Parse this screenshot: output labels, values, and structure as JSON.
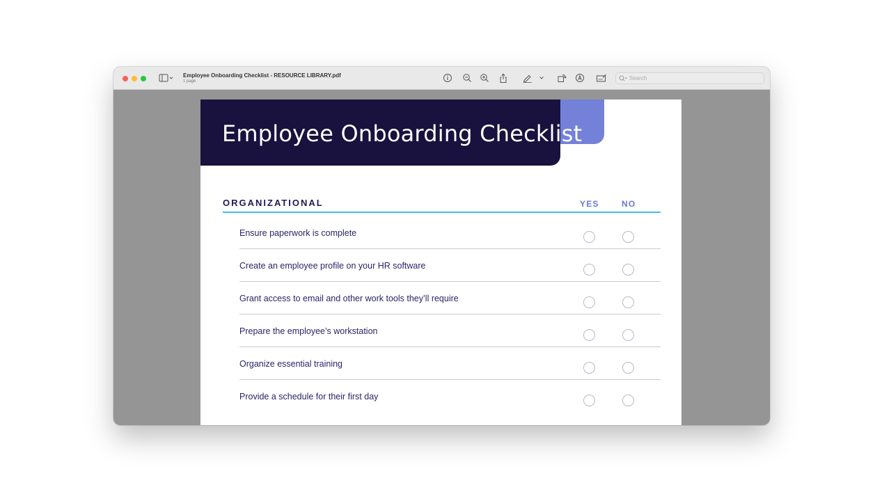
{
  "window": {
    "title": "Employee Onboarding Checklist - RESOURCE LIBRARY.pdf",
    "subtitle": "1 page"
  },
  "toolbar": {
    "icons": [
      "sidebar-icon",
      "chevron-down-icon",
      "info-icon",
      "zoom-out-icon",
      "zoom-in-icon",
      "share-icon",
      "markup-pen-icon",
      "chevron-down-icon",
      "rotate-icon",
      "highlight-icon",
      "form-fill-icon"
    ],
    "search_placeholder": "Search"
  },
  "document": {
    "title": "Employee Onboarding Checklist",
    "section": "ORGANIZATIONAL",
    "col_yes": "YES",
    "col_no": "NO",
    "items": [
      {
        "label": "Ensure paperwork is complete"
      },
      {
        "label": "Create an employee profile on your HR software"
      },
      {
        "label": "Grant access to email and other work tools they’ll require"
      },
      {
        "label": "Prepare the employee’s workstation"
      },
      {
        "label": "Organize essential training"
      },
      {
        "label": "Provide a schedule for their first day"
      }
    ],
    "colors": {
      "header_bg": "#19113e",
      "header_accent": "#7481d9",
      "section_rule": "#48bce8",
      "item_text": "#2a2469"
    }
  }
}
